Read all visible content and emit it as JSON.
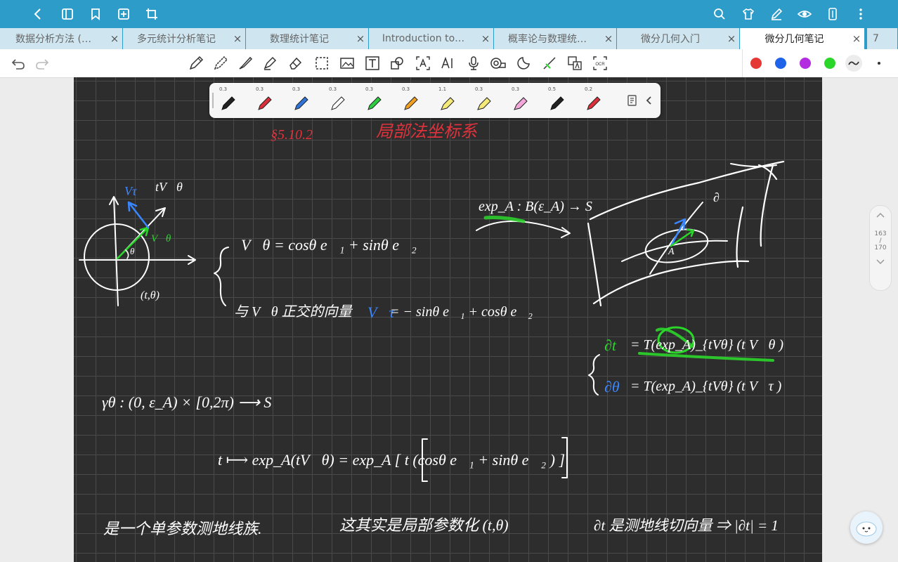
{
  "topbar": {
    "icons": [
      "back-icon",
      "sidebar-icon",
      "bookmark-icon",
      "add-page-icon",
      "crop-icon",
      "search-icon",
      "theme-shirt-icon",
      "pen-edit-icon",
      "eye-icon",
      "page-layout-icon",
      "more-vertical-icon"
    ]
  },
  "tabs": [
    {
      "label": "数据分析方法 (…",
      "active": false
    },
    {
      "label": "多元统计分析笔记",
      "active": false
    },
    {
      "label": "数理统计笔记",
      "active": false
    },
    {
      "label": "Introduction to…",
      "active": false
    },
    {
      "label": "概率论与数理统…",
      "active": false
    },
    {
      "label": "微分几何入门",
      "active": false
    },
    {
      "label": "微分几何笔记",
      "active": true
    },
    {
      "label": "7",
      "active": false
    }
  ],
  "toolbar": {
    "colors": [
      "#e53935",
      "#1e63e8",
      "#b42ce0",
      "#2bd62b"
    ]
  },
  "pens": [
    {
      "width": "0.3",
      "color": "#222222"
    },
    {
      "width": "0.3",
      "color": "#d9303a"
    },
    {
      "width": "0.3",
      "color": "#2f74d8"
    },
    {
      "width": "0.3",
      "color": "#ffffff"
    },
    {
      "width": "0.3",
      "color": "#2ecc40"
    },
    {
      "width": "0.3",
      "color": "#f0a020"
    },
    {
      "width": "1.1",
      "color": "#f3ea7a"
    },
    {
      "width": "0.3",
      "color": "#f3ea7a"
    },
    {
      "width": "0.3",
      "color": "#f3a6d8"
    },
    {
      "width": "0.5",
      "color": "#222222"
    },
    {
      "width": "0.2",
      "color": "#d9303a"
    }
  ],
  "page": {
    "current": "163",
    "separator": "/",
    "total": "170"
  },
  "note": {
    "section": "§5.10.2",
    "title": "局部法坐标系",
    "label_vtau": "Vτ",
    "label_tvtheta": "tV⃗θ",
    "label_vtheta": "V⃗θ",
    "label_theta": "θ",
    "label_ttheta": "(t,θ)",
    "eq1": "V⃗θ = cosθ e⃗₁ + sinθ e⃗₂",
    "eq2_prefix": "与 V⃗θ 正交的向量",
    "eq2_v": "V⃗τ",
    "eq2_rhs": "= − sinθ e⃗₁ + cosθ e⃗₂",
    "exp_map": "exp_A : B(ε_A) → S",
    "label_A": "A",
    "label_partial": "∂",
    "dt_lhs": "∂t",
    "dt_rhs": "= T(exp_A)_{tVθ} (t V⃗θ )",
    "dth_lhs": "∂θ",
    "dth_rhs": "= T(exp_A)_{tVθ} (t V⃗τ )",
    "gamma": "γθ : (0, ε_A) × [0,2π) ⟶ S",
    "map_line": "t ⟼ exp_A(tV⃗θ) =  exp_A [ t (cosθ e⃗₁ + sinθ e⃗₂ ) ]",
    "foot1": "是一个单参数测地线族.",
    "foot2": "这其实是局部参数化 (t,θ)",
    "foot3": "∂t 是测地线切向量 ⇒ |∂t| = 1"
  }
}
